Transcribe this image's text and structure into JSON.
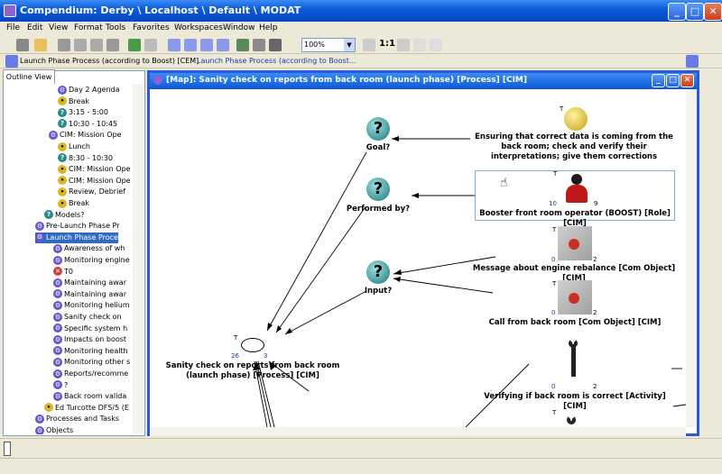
{
  "window": {
    "title": "Compendium: Derby \\ Localhost \\ Default \\ MODAT"
  },
  "menu": [
    "File",
    "Edit",
    "View",
    "Format",
    "Tools",
    "Favorites",
    "Workspaces",
    "Window",
    "Help"
  ],
  "toolbar": {
    "zoom": "100%",
    "zoom_label": "1:1"
  },
  "breadcrumbs": {
    "first": "Launch Phase Process (according to Boost) [CEM]",
    "second": "Launch Phase Process (according to Boost..."
  },
  "outline": {
    "tab": "Outline View",
    "items": [
      {
        "label": "Day 2 Agenda",
        "icon": "map"
      },
      {
        "label": "Break",
        "icon": "bulb"
      },
      {
        "label": "3:15 - 5:00",
        "icon": "q"
      },
      {
        "label": "10:30 - 10:45",
        "icon": "q"
      },
      {
        "label": "CIM: Mission Ope",
        "icon": "map"
      },
      {
        "label": "Lunch",
        "icon": "bulb"
      },
      {
        "label": "8:30 - 10:30",
        "icon": "q"
      },
      {
        "label": "CIM: Mission Ope",
        "icon": "bulb"
      },
      {
        "label": "CIM: Mission Ope",
        "icon": "bulb"
      },
      {
        "label": "Review, Debrief",
        "icon": "bulb"
      },
      {
        "label": "Break",
        "icon": "bulb"
      },
      {
        "label": "Models?",
        "icon": "q"
      },
      {
        "label": "Pre-Launch Phase Pr",
        "icon": "map"
      },
      {
        "label": "Launch Phase Proce",
        "icon": "map"
      },
      {
        "label": "Awareness of wh",
        "icon": "map"
      },
      {
        "label": "Monitoring engine",
        "icon": "map"
      },
      {
        "label": "T0",
        "icon": "x"
      },
      {
        "label": "Maintaining awar",
        "icon": "map"
      },
      {
        "label": "Maintaining awar",
        "icon": "map"
      },
      {
        "label": "Monitoring helium",
        "icon": "map"
      },
      {
        "label": "Sanity check on",
        "icon": "map"
      },
      {
        "label": "Specific system h",
        "icon": "map"
      },
      {
        "label": "Impacts on boost",
        "icon": "map"
      },
      {
        "label": "Monitoring health",
        "icon": "map"
      },
      {
        "label": "Monitoring other s",
        "icon": "map"
      },
      {
        "label": "Reports/recomme",
        "icon": "map"
      },
      {
        "label": "?",
        "icon": "map"
      },
      {
        "label": "Back room valida",
        "icon": "map"
      },
      {
        "label": "Ed Turcotte DF5/5 (E",
        "icon": "bulb"
      },
      {
        "label": "Processes and Tasks",
        "icon": "map"
      },
      {
        "label": "Objects",
        "icon": "map"
      }
    ]
  },
  "map": {
    "title": "[Map]: Sanity check on reports from back room (launch phase) [Process] [CIM]",
    "nodes": {
      "goal": "Goal?",
      "performed": "Performed by?",
      "input": "Input?",
      "ensuring": "Ensuring that correct data is coming from the back room; check and verify their interpretations; give them corrections",
      "booster": "Booster front room operator (BOOST) [Role] [CIM]",
      "booster_left": "10",
      "booster_right": "9",
      "message": "Message about engine rebalance [Com Object] [CIM]",
      "message_left": "0",
      "message_right": "2",
      "call": "Call from back room [Com Object] [CIM]",
      "call_left": "0",
      "call_right": "2",
      "verifying": "Verifying if back room is correct [Activity] [CIM]",
      "verifying_left": "0",
      "verifying_right": "2",
      "sanity": "Sanity check on reports from back room (launch phase) [Process] [CIM]",
      "sanity_left": "26",
      "sanity_right": "3",
      "t": "T"
    }
  }
}
